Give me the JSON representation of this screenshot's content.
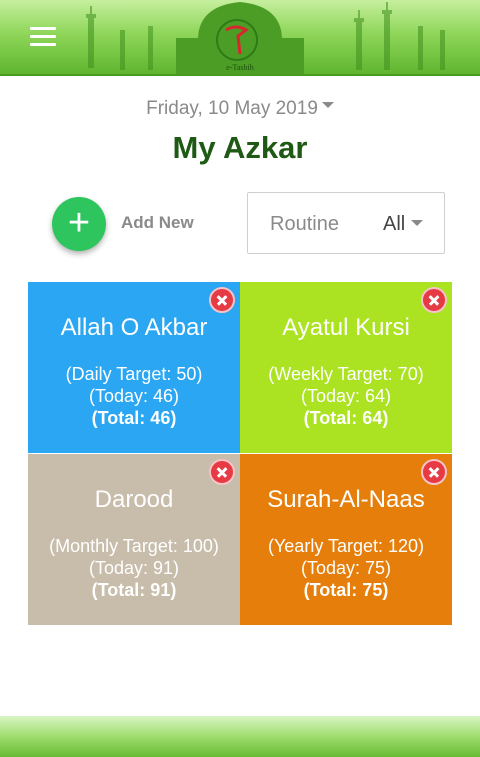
{
  "header": {
    "menu_icon": "hamburger-icon",
    "logo_text": "e-Tasbih",
    "colors": {
      "top": "#c6ef9e",
      "bottom": "#5fb52e"
    }
  },
  "date": {
    "label": "Friday, 10 May 2019"
  },
  "page": {
    "title": "My Azkar"
  },
  "actions": {
    "add_label": "Add New",
    "add_icon": "plus-icon"
  },
  "routine": {
    "label": "Routine",
    "selected": "All"
  },
  "cards": [
    {
      "title": "Allah O Akbar",
      "target": "(Daily Target: 50)",
      "today": "(Today: 46)",
      "total": "(Total: 46)",
      "color": "#2ba6f2"
    },
    {
      "title": "Ayatul Kursi",
      "target": "(Weekly Target: 70)",
      "today": "(Today: 64)",
      "total": "(Total: 64)",
      "color": "#abe322"
    },
    {
      "title": "Darood",
      "target": "(Monthly Target: 100)",
      "today": "(Today: 91)",
      "total": "(Total: 91)",
      "color": "#c8bcab"
    },
    {
      "title": "Surah-Al-Naas",
      "target": "(Yearly Target: 120)",
      "today": "(Today: 75)",
      "total": "(Total: 75)",
      "color": "#e57e0b"
    }
  ]
}
